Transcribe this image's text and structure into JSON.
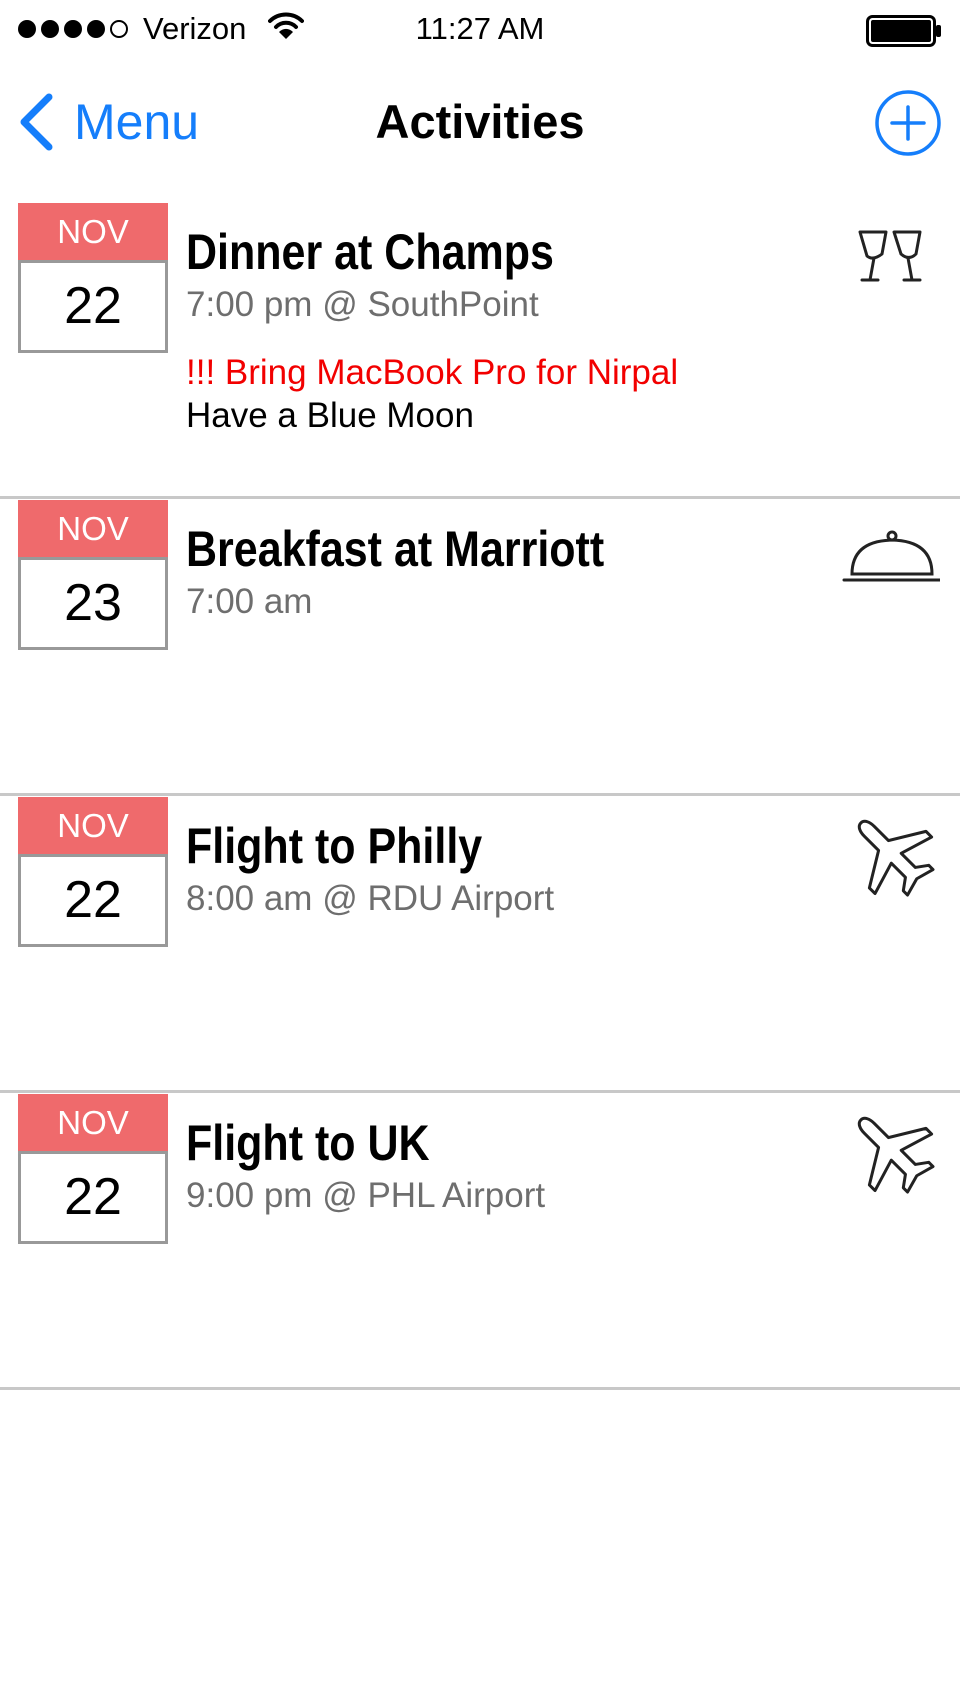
{
  "status_bar": {
    "signal_bars_filled": 4,
    "signal_bars_total": 5,
    "carrier": "Verizon",
    "time": "11:27 AM",
    "wifi_icon": "wifi-icon",
    "battery_icon": "battery-full-icon"
  },
  "nav": {
    "back_label": "Menu",
    "back_icon": "chevron-left-icon",
    "title": "Activities",
    "add_icon": "plus-circle-icon",
    "accent_color": "#157efb"
  },
  "activities": [
    {
      "month": "NOV",
      "day": "22",
      "title": "Dinner at Champs",
      "time": "7:00 pm @ SouthPoint",
      "note_alert": "!!! Bring MacBook Pro for Nirpal",
      "note": "Have a Blue Moon",
      "icon": "wine-glasses-icon"
    },
    {
      "month": "NOV",
      "day": "23",
      "title": "Breakfast at Marriott",
      "time": "7:00 am",
      "note_alert": "",
      "note": "",
      "icon": "food-cloche-icon"
    },
    {
      "month": "NOV",
      "day": "22",
      "title": "Flight to Philly",
      "time": "8:00 am @ RDU Airport",
      "note_alert": "",
      "note": "",
      "icon": "airplane-icon"
    },
    {
      "month": "NOV",
      "day": "22",
      "title": "Flight to UK",
      "time": "9:00 pm @ PHL Airport",
      "note_alert": "",
      "note": "",
      "icon": "airplane-icon"
    }
  ],
  "colors": {
    "calendar_header": "#ef6a6c",
    "alert_text": "#f20000",
    "secondary_text": "#6e6e6e",
    "separator": "#c8c8c8"
  }
}
